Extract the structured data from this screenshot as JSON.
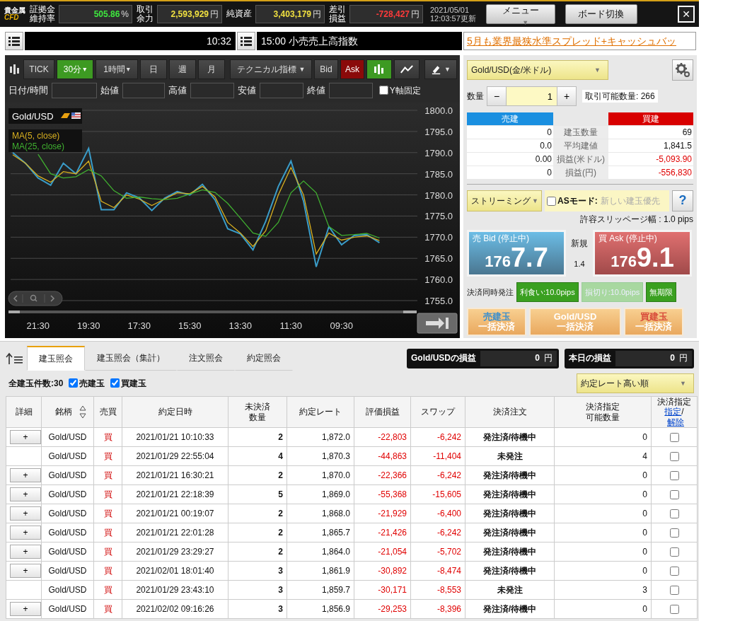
{
  "header": {
    "logo": {
      "line1": "貴金属",
      "line2": "CFD"
    },
    "metrics": [
      {
        "label": "証拠金維持率",
        "value": "505.86",
        "unit": "%",
        "color": "#3ee83e"
      },
      {
        "label": "取引余力",
        "value": "2,593,929",
        "unit": "円",
        "color": "#f0e040"
      },
      {
        "label": "純資産",
        "value": "3,403,179",
        "unit": "円",
        "color": "#f0e040"
      },
      {
        "label": "差引損益",
        "value": "-728,427",
        "unit": "円",
        "color": "#ff3a3a"
      }
    ],
    "updated_date": "2021/05/01",
    "updated_time": "12:03:57更新",
    "menu_button": "メニュー",
    "menu_caret": "▼",
    "switch_button": "ボード切換",
    "close_button": "✕"
  },
  "ticker": {
    "time": "10:32",
    "headline": "15:00 小売売上高指数",
    "promo_link": "5月も業界最狭水準スプレッド+キャッシュバッ"
  },
  "chart_panel": {
    "periods": [
      {
        "label": "TICK",
        "selected": false
      },
      {
        "label": "30分",
        "caret": "▾",
        "selected": true
      },
      {
        "label": "1時間",
        "caret": "▾",
        "selected": false
      },
      {
        "label": "日",
        "selected": false
      },
      {
        "label": "週",
        "selected": false
      },
      {
        "label": "月",
        "selected": false
      }
    ],
    "indicator_button": "テクニカル指標",
    "indicator_caret": "▼",
    "price_sides": [
      {
        "label": "Bid",
        "selected": false
      },
      {
        "label": "Ask",
        "selected": true
      }
    ],
    "chart_styles": [
      {
        "kind": "candle",
        "selected": true
      },
      {
        "kind": "line",
        "selected": false
      }
    ],
    "draw_caret": "▼",
    "fields": [
      {
        "label": "日付/時間"
      },
      {
        "label": "始値"
      },
      {
        "label": "高値"
      },
      {
        "label": "安値"
      },
      {
        "label": "終値"
      }
    ],
    "y_axis_lock": {
      "label": "Y軸固定",
      "checked": false
    },
    "symbol": "Gold/USD",
    "chart_data": {
      "type": "line",
      "categories": [
        null,
        null,
        "21:30",
        null,
        null,
        null,
        "19:30",
        null,
        null,
        null,
        "17:30",
        null,
        null,
        null,
        "15:30",
        null,
        null,
        null,
        "13:30",
        null,
        null,
        null,
        "11:30",
        null,
        null,
        null,
        "09:30",
        null,
        null,
        null
      ],
      "series": [
        {
          "color": "#3a9cc8",
          "values": [
            1790,
            1787.5,
            1784,
            1782.3,
            1787.5,
            1785,
            1791,
            1776.5,
            1776.5,
            1780.5,
            1779.3,
            1776.3,
            1779.2,
            1780.8,
            1780,
            1782.5,
            1778.8,
            1772,
            1770.8,
            1767,
            1773.7,
            1782,
            1788,
            1778.5,
            1763,
            1772.5,
            1768.2,
            1770.4,
            1770.6,
            1768.7
          ]
        },
        {
          "name": "MA(5, close)",
          "color": "#d8b020",
          "values": [
            1789.5,
            1787.5,
            1784.5,
            1783,
            1785.5,
            1785,
            1788,
            1778.5,
            1777,
            1780,
            1779,
            1777.5,
            1779,
            1780.5,
            1780.3,
            1782,
            1779.5,
            1773.5,
            1771,
            1767.8,
            1771.5,
            1780,
            1786.5,
            1780,
            1766,
            1771,
            1769.3,
            1770,
            1770.3,
            1769.2
          ]
        },
        {
          "name": "MA(25, close)",
          "color": "#40b030",
          "values": [
            null,
            null,
            1789.6,
            1785,
            1784,
            1784.3,
            1786,
            1784.5,
            1781,
            1779.2,
            1779.5,
            1779.1,
            1778.9,
            1779.2,
            1780.2,
            1781.2,
            1780.6,
            1778,
            1774.5,
            1771,
            1770.2,
            1773.5,
            1780.5,
            1783.3,
            1780.5,
            1772.5,
            1770.4,
            1770.6,
            1770.9,
            1769.8
          ]
        }
      ],
      "grid": true,
      "ylim": [
        1755,
        1800
      ],
      "yticks": [
        {
          "value": 1800,
          "label": "1800.0"
        },
        {
          "value": 1795,
          "label": "1795.0"
        },
        {
          "value": 1790,
          "label": "1790.0"
        },
        {
          "value": 1785,
          "label": "1785.0"
        },
        {
          "value": 1780,
          "label": "1780.0"
        },
        {
          "value": 1775,
          "label": "1775.0"
        },
        {
          "value": 1770,
          "label": "1770.0"
        },
        {
          "value": 1765,
          "label": "1765.0"
        },
        {
          "value": 1760,
          "label": "1760.0"
        },
        {
          "value": 1755,
          "label": "1755.0"
        }
      ]
    }
  },
  "order_panel": {
    "pair_select": "Gold/USD(金/米ドル)",
    "select_caret": "▼",
    "quantity_label": "数量",
    "minus": "−",
    "quantity": "1",
    "plus": "+",
    "available": "取引可能数量: 266",
    "sell_header": "売建",
    "buy_header": "買建",
    "positions": [
      {
        "sell": "0",
        "label": "建玉数量",
        "buy": "69",
        "negative": false
      },
      {
        "sell": "0.0",
        "label": "平均建値",
        "buy": "1,841.5",
        "negative": false
      },
      {
        "sell": "0.00",
        "label": "損益(米ドル)",
        "buy": "-5,093.90",
        "negative": true
      },
      {
        "sell": "0",
        "label": "損益(円)",
        "buy": "-556,830",
        "negative": true
      }
    ],
    "streaming_select": "ストリーミング",
    "streaming_caret": "▼",
    "as_mode": {
      "label": "ASモード:",
      "value": "新しい建玉優先",
      "checked": false
    },
    "help": "?",
    "slippage": "許容スリッページ幅 : 1.0 pips",
    "bid": {
      "title": "売 Bid (停止中)",
      "price_head": "176",
      "price_tail": "7.7"
    },
    "spread_label": "新規",
    "spread": "1.4",
    "ask": {
      "title": "買 Ask (停止中)",
      "price_head": "176",
      "price_tail": "9.1"
    },
    "auto_settle_label": "決済同時発注",
    "settle_options": [
      {
        "label": "利食い:10.0pips",
        "on": true
      },
      {
        "label": "損切り:10.0pips",
        "on": false
      },
      {
        "label": "無期限",
        "on": true
      }
    ],
    "bulk_buttons": [
      {
        "top": "売建玉",
        "bottom": "一括決済",
        "color": "#3d8fcc"
      },
      {
        "top": "Gold/USD",
        "bottom": "一括決済",
        "color": "#ffffff"
      },
      {
        "top": "買建玉",
        "bottom": "一括決済",
        "color": "#d84a3a"
      }
    ]
  },
  "positions_view": {
    "tabs": [
      {
        "label": "建玉照会",
        "selected": true
      },
      {
        "label": "建玉照会（集計）",
        "selected": false
      },
      {
        "label": "注文照会",
        "selected": false
      },
      {
        "label": "約定照会",
        "selected": false
      }
    ],
    "pl_boxes": [
      {
        "label": "Gold/USDの損益",
        "value": "0",
        "unit": "円"
      },
      {
        "label": "本日の損益",
        "value": "0",
        "unit": "円"
      }
    ],
    "count": "全建玉件数:30",
    "filters": [
      {
        "label": "売建玉",
        "checked": true
      },
      {
        "label": "買建玉",
        "checked": true
      }
    ],
    "sort_select": "約定レート高い順",
    "sort_caret": "▼",
    "table": {
      "columns": [
        {
          "label": "詳細",
          "kind": "plain"
        },
        {
          "label": "銘柄",
          "kind": "sortable"
        },
        {
          "label": "売買",
          "kind": "plain"
        },
        {
          "label": "約定日時",
          "kind": "plain"
        },
        {
          "label": "未決済数量",
          "kind": "two_line"
        },
        {
          "label": "約定レート",
          "kind": "plain"
        },
        {
          "label": "評価損益",
          "kind": "plain"
        },
        {
          "label": "スワップ",
          "kind": "plain"
        },
        {
          "label": "決済注文",
          "kind": "plain"
        },
        {
          "label": "決済指定可能数量",
          "kind": "two_line"
        },
        {
          "label": "決済指定",
          "kind": "links",
          "links": [
            "指定",
            "解除"
          ],
          "separator": "/"
        }
      ],
      "rows": [
        {
          "detail": "+",
          "symbol": "Gold/USD",
          "side": "買",
          "kind": "buy",
          "date": "2021/01/21 10:10:33",
          "qty": "2",
          "rate": "1,872.0",
          "pl": "-22,803",
          "swap": "-6,242",
          "negative": true,
          "order": "発注済/待機中",
          "settleable": "0",
          "checked": false
        },
        {
          "symbol": "Gold/USD",
          "side": "買",
          "kind": "buy",
          "date": "2021/01/29 22:55:04",
          "qty": "4",
          "rate": "1,870.3",
          "pl": "-44,863",
          "swap": "-11,404",
          "negative": true,
          "order": "未発注",
          "settleable": "4",
          "checked": false
        },
        {
          "detail": "+",
          "symbol": "Gold/USD",
          "side": "買",
          "kind": "buy",
          "date": "2021/01/21 16:30:21",
          "qty": "2",
          "rate": "1,870.0",
          "pl": "-22,366",
          "swap": "-6,242",
          "negative": true,
          "order": "発注済/待機中",
          "settleable": "0",
          "checked": false
        },
        {
          "detail": "+",
          "symbol": "Gold/USD",
          "side": "買",
          "kind": "buy",
          "date": "2021/01/21 22:18:39",
          "qty": "5",
          "rate": "1,869.0",
          "pl": "-55,368",
          "swap": "-15,605",
          "negative": true,
          "order": "発注済/待機中",
          "settleable": "0",
          "checked": false
        },
        {
          "detail": "+",
          "symbol": "Gold/USD",
          "side": "買",
          "kind": "buy",
          "date": "2021/01/21 00:19:07",
          "qty": "2",
          "rate": "1,868.0",
          "pl": "-21,929",
          "swap": "-6,400",
          "negative": true,
          "order": "発注済/待機中",
          "settleable": "0",
          "checked": false
        },
        {
          "detail": "+",
          "symbol": "Gold/USD",
          "side": "買",
          "kind": "buy",
          "date": "2021/01/21 22:01:28",
          "qty": "2",
          "rate": "1,865.7",
          "pl": "-21,426",
          "swap": "-6,242",
          "negative": true,
          "order": "発注済/待機中",
          "settleable": "0",
          "checked": false
        },
        {
          "detail": "+",
          "symbol": "Gold/USD",
          "side": "買",
          "kind": "buy",
          "date": "2021/01/29 23:29:27",
          "qty": "2",
          "rate": "1,864.0",
          "pl": "-21,054",
          "swap": "-5,702",
          "negative": true,
          "order": "発注済/待機中",
          "settleable": "0",
          "checked": false
        },
        {
          "detail": "+",
          "symbol": "Gold/USD",
          "side": "買",
          "kind": "buy",
          "date": "2021/02/01 18:01:40",
          "qty": "3",
          "rate": "1,861.9",
          "pl": "-30,892",
          "swap": "-8,474",
          "negative": true,
          "order": "発注済/待機中",
          "settleable": "0",
          "checked": false
        },
        {
          "symbol": "Gold/USD",
          "side": "買",
          "kind": "buy",
          "date": "2021/01/29 23:43:10",
          "qty": "3",
          "rate": "1,859.7",
          "pl": "-30,171",
          "swap": "-8,553",
          "negative": true,
          "order": "未発注",
          "settleable": "3",
          "checked": false
        },
        {
          "detail": "+",
          "symbol": "Gold/USD",
          "side": "買",
          "kind": "buy",
          "date": "2021/02/02 09:16:26",
          "qty": "3",
          "rate": "1,856.9",
          "pl": "-29,253",
          "swap": "-8,396",
          "negative": true,
          "order": "発注済/待機中",
          "settleable": "0",
          "checked": false
        }
      ]
    }
  }
}
